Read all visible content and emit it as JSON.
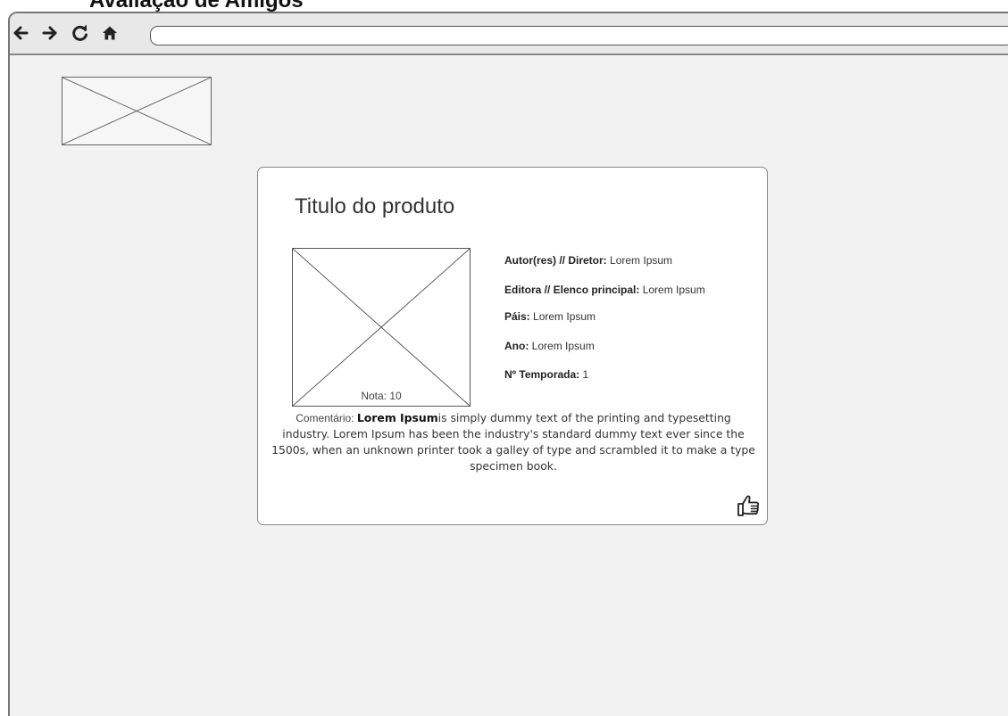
{
  "page": {
    "title": "Avaliação de Amigos"
  },
  "browser": {
    "nav": {
      "back_icon": "arrow-left-icon",
      "forward_icon": "arrow-right-icon",
      "reload_icon": "reload-icon",
      "home_icon": "home-icon"
    },
    "address_bar": {
      "value": ""
    }
  },
  "product": {
    "title": "Titulo do produto",
    "details": [
      {
        "label": "Autor(res) // Diretor:",
        "value": "Lorem Ipsum"
      },
      {
        "label": "Editora // Elenco principal:",
        "value": "Lorem Ipsum"
      },
      {
        "label": "Páis:",
        "value": "Lorem Ipsum"
      },
      {
        "label": "Ano:",
        "value": "Lorem Ipsum"
      },
      {
        "label": "Nº Temporada:",
        "value": "1"
      }
    ],
    "rating": "Nota: 10",
    "comment": {
      "label": "Comentário: ",
      "bold": "Lorem Ipsum",
      "text": "is simply dummy text of the printing and typesetting industry. Lorem Ipsum has been the industry's standard dummy text ever since the 1500s, when an unknown printer took a galley of type and scrambled it to make a type specimen book."
    },
    "like_icon": "thumbs-up-icon"
  }
}
